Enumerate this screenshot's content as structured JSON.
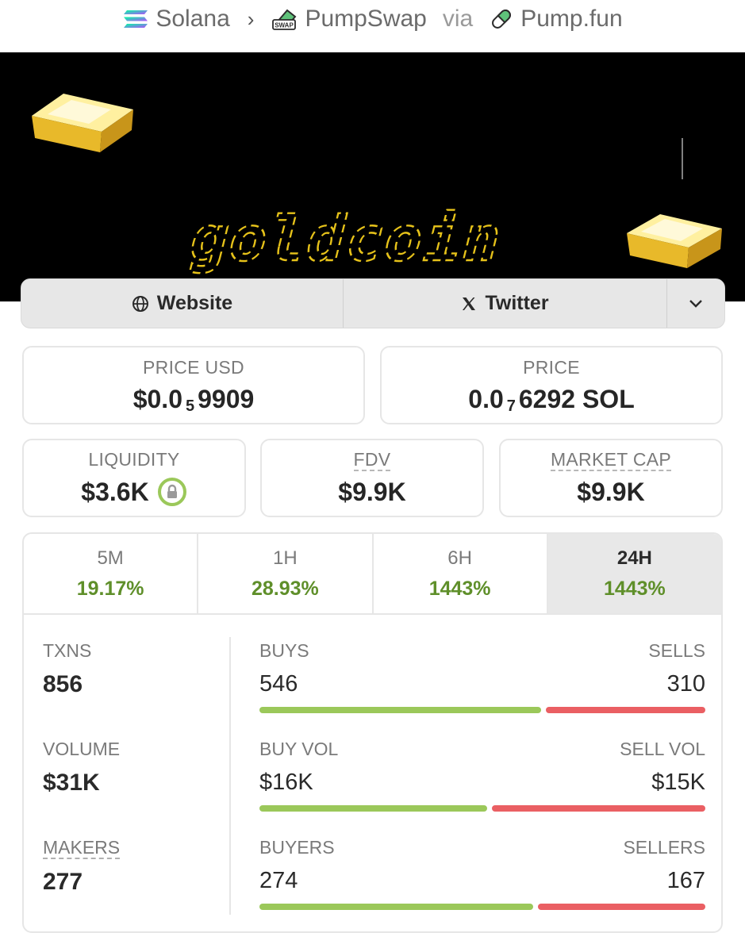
{
  "breadcrumb": {
    "chain": "Solana",
    "separator": "›",
    "dex": "PumpSwap",
    "dex_badge": "SWAP",
    "via": "via",
    "launchpad": "Pump.fun"
  },
  "banner": {
    "logo_text": "goldcoin"
  },
  "links": {
    "website": "Website",
    "twitter": "Twitter"
  },
  "price_usd": {
    "label": "PRICE USD",
    "prefix": "$0.0",
    "zeros": "5",
    "digits": "9909"
  },
  "price_native": {
    "label": "PRICE",
    "prefix": "0.0",
    "zeros": "7",
    "digits": "6292 SOL"
  },
  "liquidity": {
    "label": "LIQUIDITY",
    "value": "$3.6K"
  },
  "fdv": {
    "label": "FDV",
    "value": "$9.9K"
  },
  "market_cap": {
    "label": "MARKET CAP",
    "value": "$9.9K"
  },
  "tabs": [
    {
      "label": "5M",
      "value": "19.17%"
    },
    {
      "label": "1H",
      "value": "28.93%"
    },
    {
      "label": "6H",
      "value": "1443%"
    },
    {
      "label": "24H",
      "value": "1443%",
      "active": true
    }
  ],
  "stats": {
    "txns": {
      "label": "TXNS",
      "value": "856"
    },
    "volume": {
      "label": "VOLUME",
      "value": "$31K"
    },
    "makers": {
      "label": "MAKERS",
      "value": "277"
    },
    "rows": [
      {
        "left_label": "BUYS",
        "right_label": "SELLS",
        "left_value": "546",
        "right_value": "310",
        "buy": 546,
        "sell": 310
      },
      {
        "left_label": "BUY VOL",
        "right_label": "SELL VOL",
        "left_value": "$16K",
        "right_value": "$15K",
        "buy": 16,
        "sell": 15
      },
      {
        "left_label": "BUYERS",
        "right_label": "SELLERS",
        "left_value": "274",
        "right_value": "167",
        "buy": 274,
        "sell": 167
      }
    ]
  },
  "colors": {
    "positive": "#5f8f2a",
    "buy_bar": "#9bc85a",
    "sell_bar": "#ea5f63",
    "banner_bg": "#000000",
    "logo": "#e6c21a",
    "lock": "#9bc85a"
  }
}
